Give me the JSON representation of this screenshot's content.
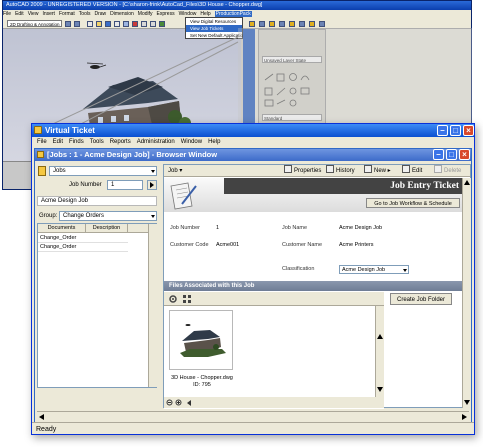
{
  "autocad": {
    "title": "AutoCAD 2009 - UNREGISTERED VERSION - [C:\\sharon-frink\\AutoCad_Files\\3D House - Chopper.dwg]",
    "menu": [
      "File",
      "Edit",
      "View",
      "Insert",
      "Format",
      "Tools",
      "Draw",
      "Dimension",
      "Modify",
      "Express",
      "Window",
      "Help",
      "ProductionPack"
    ],
    "workspace": "2D Drafting & Annotation",
    "dropdown_items": [
      "View Digital Resources",
      "View Job Tickets",
      "Set New Default Application"
    ],
    "layer_state": "Unsaved Layer State",
    "style": "Standard"
  },
  "window": {
    "title": "Virtual Ticket",
    "menu": [
      "File",
      "Edit",
      "Finds",
      "Tools",
      "Reports",
      "Administration",
      "Window",
      "Help"
    ]
  },
  "browser": {
    "title": "[Jobs : 1 - Acme Design Job] - Browser Window"
  },
  "left": {
    "entity": "Jobs",
    "job_number_label": "Job Number",
    "job_number": "1",
    "job_name": "Acme Design Job",
    "group_label": "Group:",
    "group_value": "Change Orders",
    "columns": [
      "Documents",
      "Description"
    ],
    "rows": [
      "Change_Order",
      "Change_Order"
    ]
  },
  "toolbar": {
    "job_menu": "Job",
    "properties": "Properties",
    "history": "History",
    "new": "New",
    "edit": "Edit",
    "delete": "Delete"
  },
  "ticket": {
    "header": "Job Entry Ticket",
    "workflow_button": "Go to Job Workflow & Schedule",
    "job_number_label": "Job Number",
    "job_number": "1",
    "customer_code_label": "Customer Code",
    "customer_code": "Acme001",
    "job_name_label": "Job Name",
    "job_name": "Acme Design Job",
    "customer_name_label": "Customer Name",
    "customer_name": "Acme Printers",
    "classification_label": "Classification",
    "classification": "Acme Design Job"
  },
  "files": {
    "header": "Files Associated with this Job",
    "create_folder": "Create Job Folder",
    "thumb_name": "3D House - Chopper.dwg",
    "thumb_id": "ID: 795"
  },
  "status": "Ready"
}
